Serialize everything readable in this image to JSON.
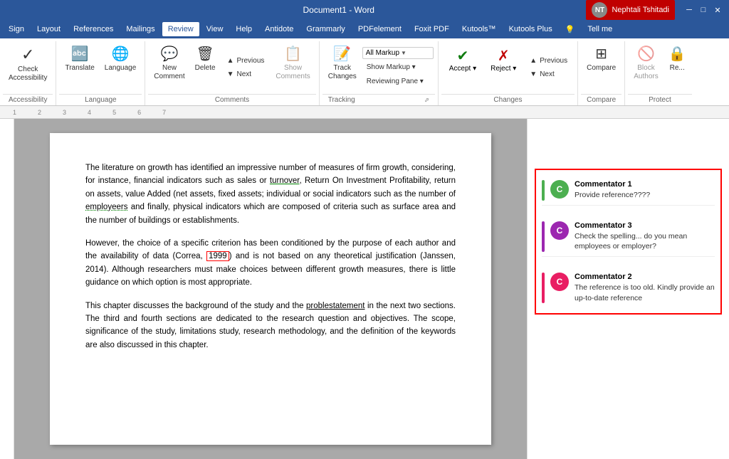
{
  "titleBar": {
    "title": "Document1 - Word",
    "user": "Nephtali Tshitadi",
    "controls": [
      "─",
      "□",
      "✕"
    ]
  },
  "menuBar": {
    "items": [
      "Sign",
      "Layout",
      "References",
      "Mailings",
      "Review",
      "View",
      "Help",
      "Antidote",
      "Grammarly",
      "PDFelement",
      "Foxit PDF",
      "Kutools™",
      "Kutools Plus",
      "💡",
      "Tell me"
    ],
    "activeItem": "Review"
  },
  "ribbon": {
    "groups": [
      {
        "label": "Accessibility",
        "buttons": [
          {
            "id": "check-accessibility",
            "icon": "✓",
            "label": "Check\nAccessibility"
          }
        ]
      },
      {
        "label": "Language",
        "buttons": [
          {
            "id": "translate",
            "icon": "🔤",
            "label": "Translate"
          },
          {
            "id": "language",
            "icon": "🌐",
            "label": "Language"
          }
        ]
      },
      {
        "label": "Comments",
        "buttons": [
          {
            "id": "new-comment",
            "icon": "💬",
            "label": "New\nComment"
          },
          {
            "id": "delete",
            "icon": "🗑",
            "label": "Delete"
          },
          {
            "id": "previous-comment",
            "icon": "▲",
            "label": "Previous"
          },
          {
            "id": "next-comment",
            "icon": "▼",
            "label": "Next"
          },
          {
            "id": "show-comments",
            "icon": "📋",
            "label": "Show\nComments",
            "disabled": true
          }
        ]
      },
      {
        "label": "Tracking",
        "buttons": [
          {
            "id": "track-changes",
            "icon": "📝",
            "label": "Track\nChanges"
          }
        ],
        "dropdowns": [
          {
            "id": "all-markup",
            "label": "All Markup"
          },
          {
            "id": "show-markup",
            "label": "Show Markup"
          },
          {
            "id": "reviewing-pane",
            "label": "Reviewing Pane"
          }
        ]
      },
      {
        "label": "Changes",
        "buttons": [
          {
            "id": "accept",
            "icon": "✔",
            "label": "Accept"
          },
          {
            "id": "reject",
            "icon": "✗",
            "label": "Reject"
          },
          {
            "id": "previous-change",
            "label": "Previous"
          },
          {
            "id": "next-change",
            "label": "Next"
          }
        ]
      },
      {
        "label": "Compare",
        "buttons": [
          {
            "id": "compare",
            "icon": "⊞",
            "label": "Compare"
          }
        ]
      },
      {
        "label": "Protect",
        "buttons": [
          {
            "id": "block-authors",
            "icon": "🔒",
            "label": "Block\nAuthors",
            "disabled": true
          }
        ]
      }
    ]
  },
  "document": {
    "paragraphs": [
      "The literature on growth has identified an impressive number of measures of firm growth, considering, for instance, financial indicators such as sales or turnover, Return On Investment Profitability, return on assets, value Added (net assets, fixed assets; individual or social indicators such as the number of employeers and finally, physical indicators which are composed of criteria such as surface area and the number of buildings or establishments.",
      "However, the choice of a specific criterion has been conditioned by the purpose of each author and the availability of data (Correa, 1999) and is not based on any theoretical justification (Janssen, 2014). Although researchers must make choices between different growth measures, there is little guidance on which option is most appropriate.",
      "This chapter discusses the background of the study and the problestatement in the next two sections. The third and fourth sections are dedicated to the research question and objectives. The scope, significance of the study, limitations study, research methodology, and the definition of the keywords are also discussed in this chapter."
    ],
    "annotations": {
      "turnover": "underline-green",
      "employeers": "underline-dotted",
      "1999": "box-red",
      "problestatement": "underline-word"
    }
  },
  "comments": [
    {
      "id": "comment-1",
      "author": "Commentator 1",
      "text": "Provide reference????",
      "avatarColor": "#4caf50",
      "barColor": "#4caf50"
    },
    {
      "id": "comment-3",
      "author": "Commentator 3",
      "text": "Check the spelling... do you mean employees or employer?",
      "avatarColor": "#9c27b0",
      "barColor": "#9c27b0"
    },
    {
      "id": "comment-2",
      "author": "Commentator 2",
      "text": "The reference is too old. Kindly provide an up-to-date reference",
      "avatarColor": "#e91e63",
      "barColor": "#e91e63"
    }
  ]
}
